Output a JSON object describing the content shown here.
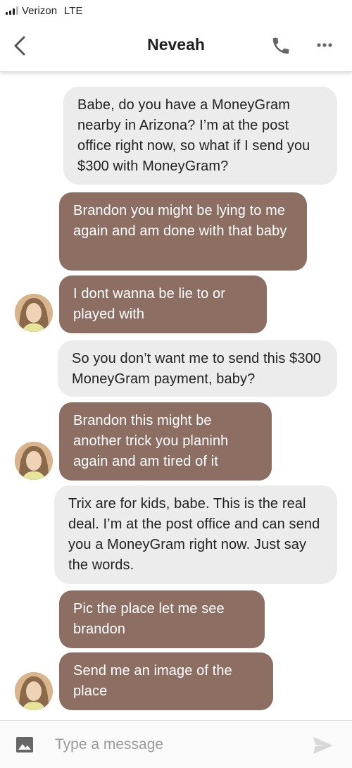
{
  "status_bar": {
    "carrier": "Verizon",
    "network": "LTE"
  },
  "header": {
    "title": "Neveah"
  },
  "messages": [
    {
      "from": "me",
      "text": "Babe, do you have a MoneyGram nearby in Arizona? I’m at the post office right now, so what if I send you $300 with MoneyGram?"
    },
    {
      "from": "them",
      "text": "Brandon you might be lying to me again and am done with that baby"
    },
    {
      "from": "them",
      "text": "I dont wanna be lie to or played with"
    },
    {
      "from": "me",
      "text": "So you don’t want me to send this $300 MoneyGram payment, baby?"
    },
    {
      "from": "them",
      "text": "Brandon this might be another trick you planinh again and am tired of it"
    },
    {
      "from": "me",
      "text": "Trix are for kids, babe. This is the real deal. I’m at the post office and can send you a MoneyGram right now. Just say the words."
    },
    {
      "from": "them",
      "text": "Pic the place let me see brandon"
    },
    {
      "from": "them",
      "text": "Send me an image of the place"
    }
  ],
  "composer": {
    "placeholder": "Type a message"
  },
  "colors": {
    "sent_bubble": "#ececec",
    "received_bubble": "#8d6e63",
    "received_text": "#ffffff"
  }
}
